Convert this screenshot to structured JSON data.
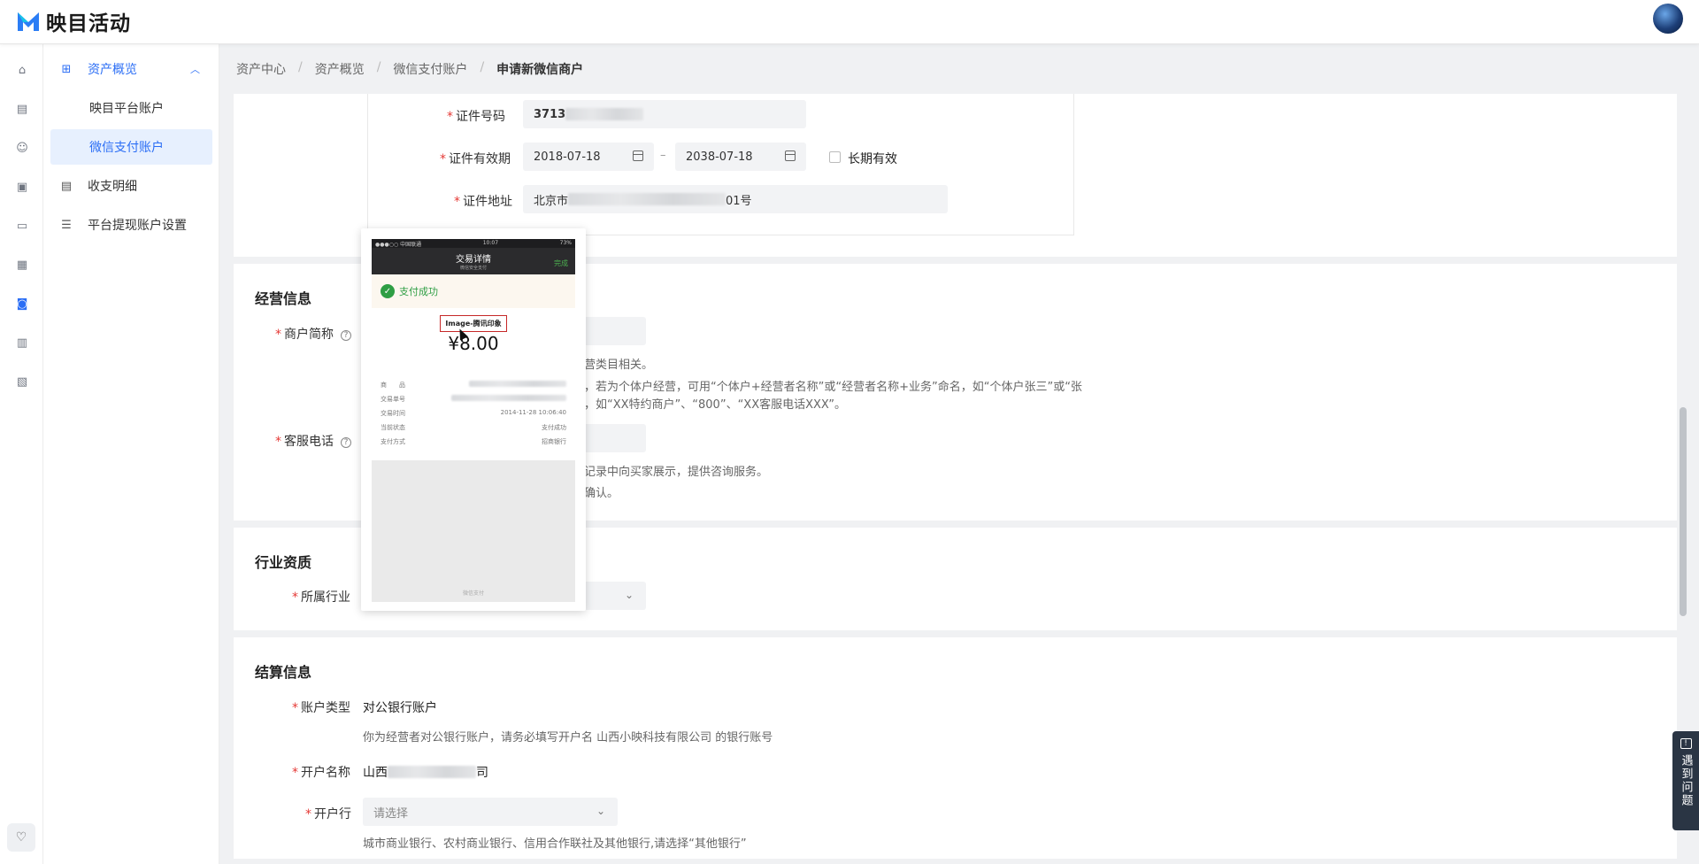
{
  "app": {
    "title": "映目活动"
  },
  "rail": {
    "icons": [
      "home-icon",
      "report-icon",
      "users-icon",
      "wallet-icon",
      "monitor-icon",
      "doc-icon",
      "asset-icon",
      "file-icon",
      "id-card-icon"
    ],
    "bottom_icon": "heart-icon"
  },
  "menu": {
    "group_label": "资产概览",
    "items": [
      {
        "label": "映目平台账户"
      },
      {
        "label": "微信支付账户"
      },
      {
        "label": "收支明细"
      },
      {
        "label": "平台提现账户设置"
      }
    ]
  },
  "breadcrumb": [
    "资产中心",
    "资产概览",
    "微信支付账户",
    "申请新微信商户"
  ],
  "identity": {
    "id_number_label": "证件号码",
    "id_number_value": "3713",
    "validity_label": "证件有效期",
    "start_date": "2018-07-18",
    "end_date": "2038-07-18",
    "date_separator": "–",
    "long_term_label": "长期有效",
    "address_label": "证件地址",
    "address_prefix": "北京市",
    "address_suffix": "01号"
  },
  "business": {
    "title": "经营信息",
    "short_name_label": "商户简称",
    "short_name_hint1": "营类目相关。",
    "short_name_hint2": "，若为个体户经营，可用“个体户+经营者名称”或“经营者名称+业务”命名，如“个体户张三”或“张",
    "short_name_hint3": "，如“XX特约商户”、“800”、“XX客服电话XXX”。",
    "phone_label": "客服电话",
    "phone_hint1": "记录中向买家展示，提供咨询服务。",
    "phone_hint2": "确认。"
  },
  "industry": {
    "title": "行业资质",
    "industry_label": "所属行业"
  },
  "settlement": {
    "title": "结算信息",
    "account_type_label": "账户类型",
    "account_type_value": "对公银行账户",
    "account_type_hint": "你为经营者对公银行账户，请务必填写开户名 山西小映科技有限公司 的银行账号",
    "account_name_label": "开户名称",
    "account_name_prefix": "山西",
    "account_name_suffix": "司",
    "bank_label": "开户行",
    "bank_placeholder": "请选择",
    "bank_hint": "城市商业银行、农村商业银行、信用合作联社及其他银行,请选择“其他银行”"
  },
  "popup": {
    "carrier": "●●●○○ 中国联通",
    "time": "10:07",
    "battery": "73%",
    "nav_title": "交易详情",
    "nav_sub": "微信安全支付",
    "done": "完成",
    "success": "支付成功",
    "tag": "Image-腾讯印象",
    "amount": "¥8.00",
    "rows": [
      {
        "k": "商　　品",
        "v": ""
      },
      {
        "k": "交易单号",
        "v": ""
      },
      {
        "k": "交易时间",
        "v": "2014-11-28 10:06:40"
      },
      {
        "k": "当前状态",
        "v": "支付成功"
      },
      {
        "k": "支付方式",
        "v": "招商银行"
      }
    ],
    "footer": "微信支付"
  },
  "help": {
    "label": "遇到问题"
  },
  "colors": {
    "accent": "#2b6ef5",
    "required": "#e53935",
    "help_bg": "#2a3544"
  }
}
